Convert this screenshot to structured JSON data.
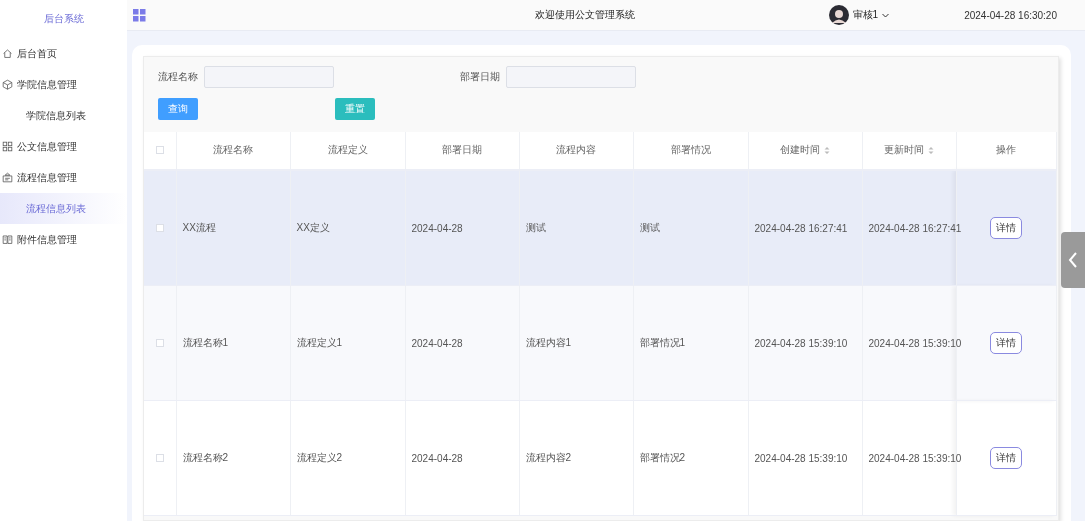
{
  "sidebar": {
    "title": "后台系统",
    "items": [
      {
        "label": "后台首页",
        "selected": false
      },
      {
        "label": "学院信息管理",
        "selected": false,
        "children": [
          {
            "label": "学院信息列表",
            "selected": false
          }
        ]
      },
      {
        "label": "公文信息管理",
        "selected": false
      },
      {
        "label": "流程信息管理",
        "selected": false,
        "children": [
          {
            "label": "流程信息列表",
            "selected": true
          }
        ]
      },
      {
        "label": "附件信息管理",
        "selected": false
      }
    ]
  },
  "header": {
    "title": "欢迎使用公文管理系统",
    "user": "审核1",
    "datetime": "2024-04-28 16:30:20"
  },
  "search": {
    "fields": [
      {
        "label": "流程名称"
      },
      {
        "label": "部署日期"
      }
    ],
    "buttons": [
      {
        "label": "查询",
        "kind": "primary"
      },
      {
        "label": "重置",
        "kind": "reset"
      }
    ]
  },
  "table": {
    "select_all_checked": false,
    "columns": [
      {
        "label": "流程名称",
        "sortable": false
      },
      {
        "label": "流程定义",
        "sortable": false
      },
      {
        "label": "部署日期",
        "sortable": false
      },
      {
        "label": "流程内容",
        "sortable": false
      },
      {
        "label": "部署情况",
        "sortable": false
      },
      {
        "label": "创建时间",
        "sortable": true
      },
      {
        "label": "更新时间",
        "sortable": true
      },
      {
        "label": "操作",
        "sortable": false
      }
    ],
    "rows": [
      {
        "selected": true,
        "checked": false,
        "cells": [
          "XX流程",
          "XX定义",
          "2024-04-28",
          "测试",
          "测试",
          "2024-04-28 16:27:41",
          "2024-04-28 16:27:41"
        ],
        "action": "详情"
      },
      {
        "selected": false,
        "checked": false,
        "cells": [
          "流程名称1",
          "流程定义1",
          "2024-04-28",
          "流程内容1",
          "部署情况1",
          "2024-04-28 15:39:10",
          "2024-04-28 15:39:10"
        ],
        "action": "详情"
      },
      {
        "selected": false,
        "checked": false,
        "cells": [
          "流程名称2",
          "流程定义2",
          "2024-04-28",
          "流程内容2",
          "部署情况2",
          "2024-04-28 15:39:10",
          "2024-04-28 15:39:10"
        ],
        "action": "详情"
      }
    ]
  }
}
